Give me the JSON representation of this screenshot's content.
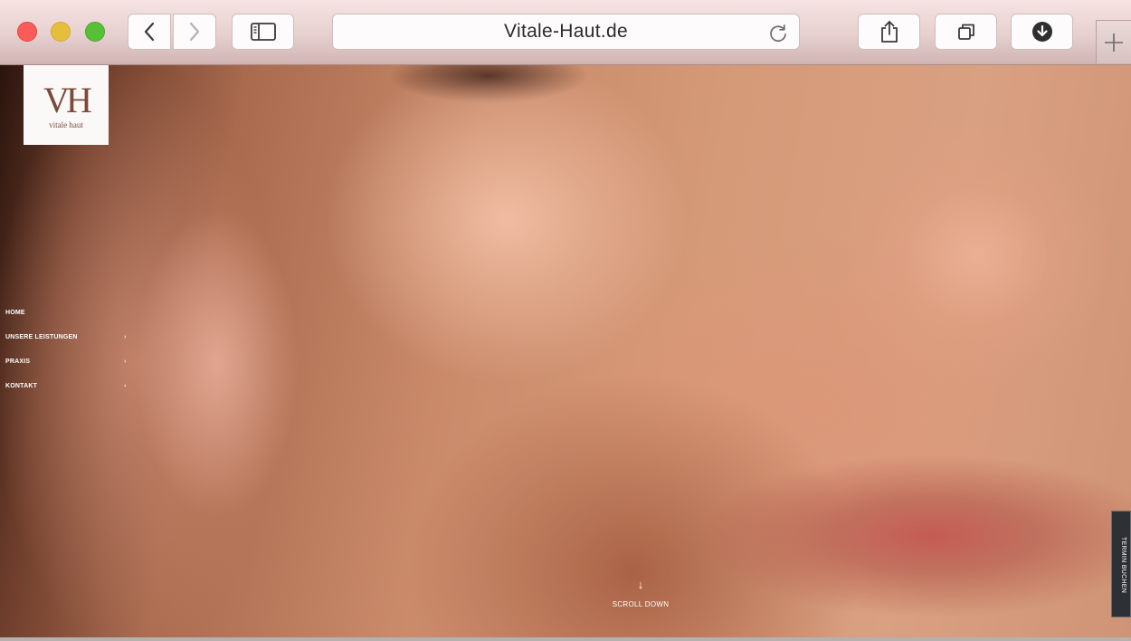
{
  "browser": {
    "address": "Vitale-Haut.de",
    "icons": {
      "back": "chevron-left-icon",
      "forward": "chevron-right-icon",
      "sidebar": "sidebar-icon",
      "reload": "reload-icon",
      "share": "share-icon",
      "tabs": "tabs-overview-icon",
      "download": "download-icon",
      "new_tab": "plus-icon"
    },
    "colors": {
      "close": "#fc5b57",
      "minimize": "#e5bf3c",
      "zoom": "#57c038"
    }
  },
  "page": {
    "logo": {
      "mark": "VH",
      "subtitle": "vitale haut"
    },
    "nav": {
      "items": [
        {
          "label": "HOME",
          "has_submenu": false
        },
        {
          "label": "UNSERE LEISTUNGEN",
          "has_submenu": true
        },
        {
          "label": "PRAXIS",
          "has_submenu": true
        },
        {
          "label": "KONTAKT",
          "has_submenu": true
        }
      ],
      "submenu_glyph": "›"
    },
    "scroll": {
      "arrow": "↓",
      "label": "SCROLL DOWN"
    },
    "termin": {
      "label": "TERMIN BUCHEN"
    }
  }
}
